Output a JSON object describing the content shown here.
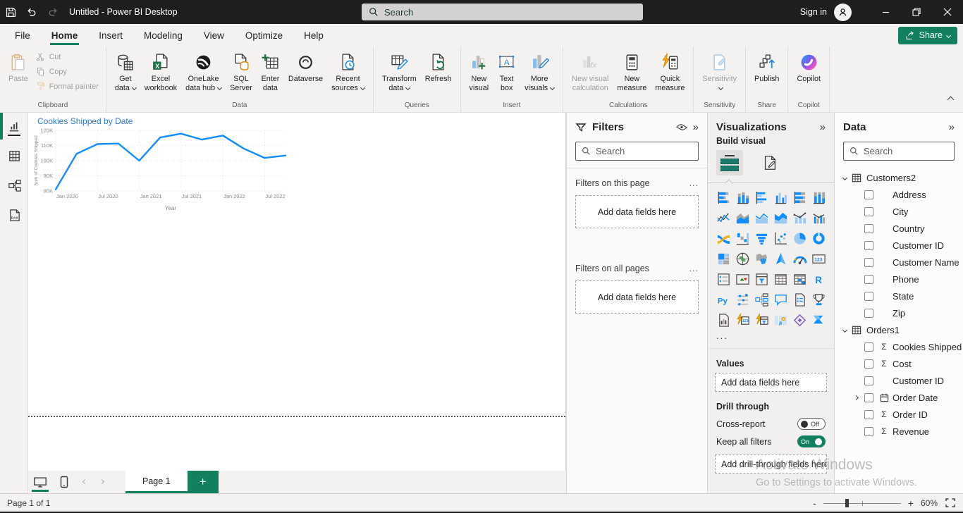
{
  "accent": "#12805F",
  "chart_data": {
    "type": "line",
    "title": "Cookies Shipped by Date",
    "xlabel": "Year",
    "ylabel": "Sum of Cookies Shipped",
    "x": [
      "Jan 2020",
      "Apr 2020",
      "Jul 2020",
      "Oct 2020",
      "Jan 2021",
      "Apr 2021",
      "Jul 2021",
      "Oct 2021",
      "Jan 2022",
      "Apr 2022",
      "Jul 2022",
      "Oct 2022"
    ],
    "values": [
      81000,
      104500,
      111000,
      111300,
      100000,
      115300,
      117800,
      113900,
      116600,
      108000,
      101800,
      103400
    ],
    "ylim": [
      80000,
      120000
    ],
    "ytick_labels": [
      "80K",
      "90K",
      "100K",
      "110K",
      "120K"
    ],
    "xtick_labels": [
      "Jan 2020",
      "Jul 2020",
      "Jan 2021",
      "Jul 2021",
      "Jan 2022",
      "Jul 2022"
    ],
    "line_color": "#118DFF",
    "title_color": "#2E7BCE",
    "grid": true,
    "legend": false
  },
  "titlebar": {
    "title": "Untitled - Power BI Desktop",
    "search_placeholder": "Search",
    "sign_in": "Sign in"
  },
  "menubar": {
    "items": [
      "File",
      "Home",
      "Insert",
      "Modeling",
      "View",
      "Optimize",
      "Help"
    ],
    "active_item": "Home",
    "share_label": "Share"
  },
  "ribbon": {
    "groups": [
      {
        "label": "Clipboard",
        "layout": "clipboard",
        "big": {
          "label": "Paste",
          "icon": "paste",
          "disabled": true
        },
        "small": [
          {
            "label": "Cut",
            "icon": "cut",
            "disabled": true
          },
          {
            "label": "Copy",
            "icon": "copy",
            "disabled": true
          },
          {
            "label": "Format painter",
            "icon": "format-painter",
            "disabled": true
          }
        ]
      },
      {
        "label": "Data",
        "buttons": [
          {
            "lines": [
              "Get",
              "data"
            ],
            "icon": "get-data",
            "dropdown": true
          },
          {
            "lines": [
              "Excel",
              "workbook"
            ],
            "icon": "excel"
          },
          {
            "lines": [
              "OneLake",
              "data hub"
            ],
            "icon": "onelake",
            "dropdown": true
          },
          {
            "lines": [
              "SQL",
              "Server"
            ],
            "icon": "sql-server"
          },
          {
            "lines": [
              "Enter",
              "data"
            ],
            "icon": "enter-data"
          },
          {
            "lines": [
              "Dataverse"
            ],
            "icon": "dataverse"
          },
          {
            "lines": [
              "Recent",
              "sources"
            ],
            "icon": "recent-sources",
            "dropdown": true
          }
        ]
      },
      {
        "label": "Queries",
        "buttons": [
          {
            "lines": [
              "Transform",
              "data"
            ],
            "icon": "transform-data",
            "dropdown": true
          },
          {
            "lines": [
              "Refresh"
            ],
            "icon": "refresh"
          }
        ]
      },
      {
        "label": "Insert",
        "buttons": [
          {
            "lines": [
              "New",
              "visual"
            ],
            "icon": "new-visual"
          },
          {
            "lines": [
              "Text",
              "box"
            ],
            "icon": "text-box"
          },
          {
            "lines": [
              "More",
              "visuals"
            ],
            "icon": "more-visuals",
            "dropdown": true
          }
        ]
      },
      {
        "label": "Calculations",
        "buttons": [
          {
            "lines": [
              "New visual",
              "calculation"
            ],
            "icon": "new-visual-calculation",
            "disabled": true
          },
          {
            "lines": [
              "New",
              "measure"
            ],
            "icon": "new-measure"
          },
          {
            "lines": [
              "Quick",
              "measure"
            ],
            "icon": "quick-measure"
          }
        ]
      },
      {
        "label": "Sensitivity",
        "buttons": [
          {
            "lines": [
              "Sensitivity"
            ],
            "icon": "sensitivity",
            "disabled": true,
            "dropdown": true
          }
        ]
      },
      {
        "label": "Share",
        "buttons": [
          {
            "lines": [
              "Publish"
            ],
            "icon": "publish"
          }
        ]
      },
      {
        "label": "Copilot",
        "buttons": [
          {
            "lines": [
              "Copilot"
            ],
            "icon": "copilot"
          }
        ]
      }
    ]
  },
  "sidebar": {
    "views": [
      "report-view",
      "table-view",
      "model-view",
      "dax-query-view"
    ],
    "active_view": "report-view"
  },
  "canvas": {
    "visual_title": "Cookies Shipped by Date"
  },
  "filters": {
    "title": "Filters",
    "search_placeholder": "Search",
    "header_icons": [
      "funnel-icon",
      "eye-icon",
      "collapse-icon"
    ],
    "sections": [
      {
        "label": "Filters on this page",
        "more": "...",
        "drop_hint": "Add data fields here"
      },
      {
        "label": "Filters on all pages",
        "more": "...",
        "drop_hint": "Add data fields here"
      }
    ]
  },
  "visualizations": {
    "title": "Visualizations",
    "build_section_label": "Build visual",
    "icons": [
      "stacked-bar-chart",
      "stacked-column-chart",
      "clustered-bar-chart",
      "clustered-column-chart",
      "100-stacked-bar-chart",
      "100-stacked-column-chart",
      "line-chart",
      "area-chart",
      "stacked-area-chart",
      "100-stacked-area-chart",
      "line-and-stacked-column-chart",
      "line-and-clustered-column-chart",
      "ribbon-chart",
      "waterfall-chart",
      "funnel-chart",
      "scatter-chart",
      "pie-chart",
      "donut-chart",
      "treemap",
      "map",
      "filled-map",
      "azure-map",
      "gauge",
      "card",
      "multi-row-card",
      "kpi",
      "slicer",
      "table",
      "matrix",
      "r-script-visual",
      "python-visual",
      "key-influencers",
      "decomposition-tree",
      "qa-visual",
      "smart-narrative",
      "metrics",
      "paginated-report",
      "card-new",
      "slicer-new",
      "arcgis-map",
      "power-apps",
      "power-automate"
    ],
    "more": "...",
    "values_label": "Values",
    "values_drop_hint": "Add data fields here",
    "drill_label": "Drill through",
    "cross_report_label": "Cross-report",
    "cross_report_state": "Off",
    "keep_filters_label": "Keep all filters",
    "keep_filters_state": "On",
    "drill_drop_hint": "Add drill-through fields here"
  },
  "data_pane": {
    "title": "Data",
    "search_placeholder": "Search",
    "tables": [
      {
        "name": "Customers2",
        "expanded": true,
        "fields": [
          {
            "name": "Address"
          },
          {
            "name": "City"
          },
          {
            "name": "Country"
          },
          {
            "name": "Customer ID"
          },
          {
            "name": "Customer Name"
          },
          {
            "name": "Phone"
          },
          {
            "name": "State"
          },
          {
            "name": "Zip"
          }
        ]
      },
      {
        "name": "Orders1",
        "expanded": true,
        "fields": [
          {
            "name": "Cookies Shipped",
            "sigma": true
          },
          {
            "name": "Cost",
            "sigma": true
          },
          {
            "name": "Customer ID"
          },
          {
            "name": "Order Date",
            "date": true,
            "expandable": true
          },
          {
            "name": "Order ID",
            "sigma": true
          },
          {
            "name": "Revenue",
            "sigma": true
          }
        ]
      }
    ]
  },
  "pages_bar": {
    "page_tab": "Page 1",
    "new_page_label": "+"
  },
  "status_bar": {
    "page_indicator": "Page 1 of 1",
    "zoom_out": "-",
    "zoom_in": "+",
    "zoom_level": "60%"
  },
  "watermark": {
    "line1": "Activate Windows",
    "line2": "Go to Settings to activate Windows."
  }
}
